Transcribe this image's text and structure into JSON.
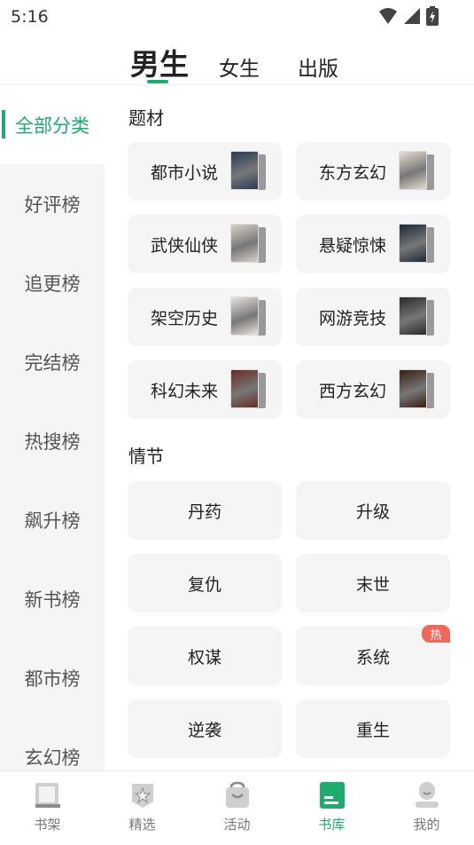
{
  "status": {
    "time": "5:16"
  },
  "header": {
    "tabs": [
      "男生",
      "女生",
      "出版"
    ],
    "active_tab": 0
  },
  "sidebar": {
    "items": [
      "全部分类",
      "好评榜",
      "追更榜",
      "完结榜",
      "热搜榜",
      "飙升榜",
      "新书榜",
      "都市榜",
      "玄幻榜"
    ],
    "active": 0
  },
  "sections": {
    "theme": {
      "title": "题材",
      "items": [
        {
          "label": "都市小说",
          "cover_color": "#2b3a55"
        },
        {
          "label": "东方玄幻",
          "cover_color": "#e6dcd0"
        },
        {
          "label": "武侠仙侠",
          "cover_color": "#d8d2c8"
        },
        {
          "label": "悬疑惊悚",
          "cover_color": "#1c2a3a"
        },
        {
          "label": "架空历史",
          "cover_color": "#e8e4de"
        },
        {
          "label": "网游竞技",
          "cover_color": "#2a2a2a"
        },
        {
          "label": "科幻未来",
          "cover_color": "#6a2a22"
        },
        {
          "label": "西方玄幻",
          "cover_color": "#3a1e14"
        }
      ]
    },
    "plot": {
      "title": "情节",
      "items": [
        "丹药",
        "升级",
        "复仇",
        "末世",
        "权谋",
        "系统",
        "逆袭",
        "重生"
      ],
      "hot_badge": "热"
    }
  },
  "colors": {
    "accent": "#1faa6e",
    "hot": "#f0685a"
  },
  "bottom_nav": {
    "items": [
      {
        "label": "书架",
        "icon": "bookshelf-icon"
      },
      {
        "label": "精选",
        "icon": "featured-icon"
      },
      {
        "label": "活动",
        "icon": "activity-icon"
      },
      {
        "label": "书库",
        "icon": "library-icon"
      },
      {
        "label": "我的",
        "icon": "profile-icon"
      }
    ],
    "active": 3
  }
}
